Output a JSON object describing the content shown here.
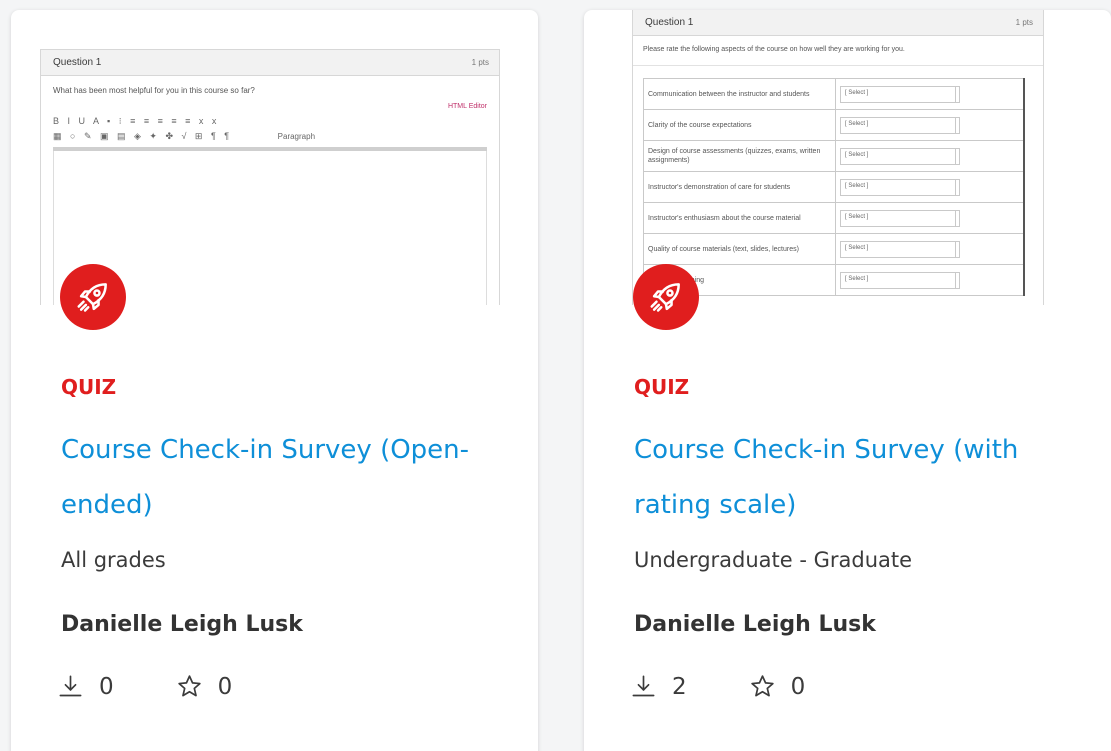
{
  "cards": [
    {
      "type_label": "QUIZ",
      "title": "Course Check-in Survey (Open-ended)",
      "grades": "All grades",
      "author": "Danielle Leigh Lusk",
      "downloads": "0",
      "favorites": "0",
      "preview": {
        "question_title": "Question 1",
        "points": "1 pts",
        "question_text": "What has been most helpful for you in this course so far?",
        "edit_link": "HTML Editor",
        "paragraph_select": "Paragraph"
      }
    },
    {
      "type_label": "QUIZ",
      "title": "Course Check-in Survey (with rating scale)",
      "grades": "Undergraduate - Graduate",
      "author": "Danielle Leigh Lusk",
      "downloads": "2",
      "favorites": "0",
      "preview": {
        "question_title": "Question 1",
        "points": "1 pts",
        "instructions": "Please rate the following aspects of the course on how well they are working for you.",
        "select_placeholder": "[ Select ]",
        "rows": [
          "Communication between the instructor and students",
          "Clarity of the course expectations",
          "Design of course assessments (quizzes, exams, written assignments)",
          "Instructor's demonstration of care for students",
          "Instructor's enthusiasm about the course material",
          "Quality of course materials (text, slides, lectures)",
          "Pacing of learning"
        ]
      }
    }
  ],
  "colors": {
    "accent_red": "#e01e1e",
    "link_blue": "#0e8fd8"
  },
  "icons": {
    "badge": "rocket-icon",
    "downloads": "download-icon",
    "favorites": "star-icon"
  }
}
